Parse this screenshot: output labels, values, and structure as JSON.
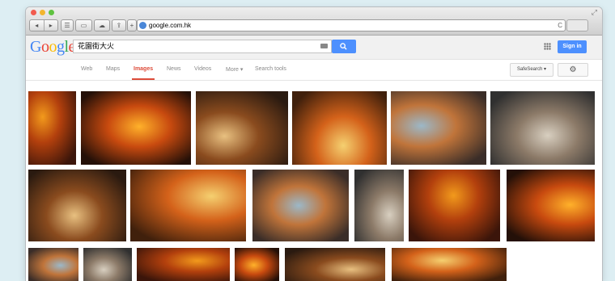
{
  "browser": {
    "toolbar_icons": [
      "back-icon",
      "forward-icon",
      "reader-icon",
      "bookmarks-icon",
      "icloud-icon",
      "share-icon",
      "new-tab-icon"
    ],
    "address": "google.com.hk",
    "reload_label": "C"
  },
  "google": {
    "logo_letters": [
      {
        "ch": "G",
        "color": "#4285f4"
      },
      {
        "ch": "o",
        "color": "#ea4335"
      },
      {
        "ch": "o",
        "color": "#fbbc05"
      },
      {
        "ch": "g",
        "color": "#4285f4"
      },
      {
        "ch": "l",
        "color": "#34a853"
      },
      {
        "ch": "e",
        "color": "#ea4335"
      }
    ],
    "query": "花園街大火",
    "sign_in": "Sign in",
    "tabs": [
      "Web",
      "Maps",
      "Images",
      "News",
      "Videos",
      "More ▾",
      "Search tools"
    ],
    "active_tab": "Images",
    "safe_search": "SafeSearch ▾",
    "settings_icon": "gear-icon"
  },
  "image_results": {
    "row_count": 3,
    "rows": [
      6,
      6,
      6
    ]
  }
}
